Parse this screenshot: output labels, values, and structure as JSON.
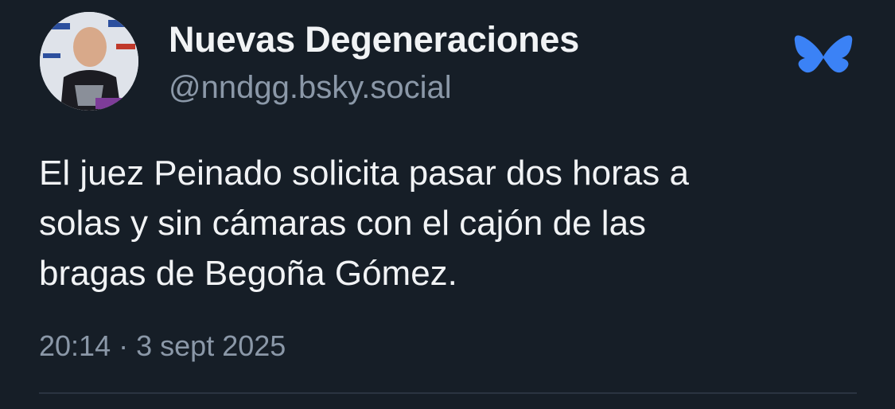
{
  "author": {
    "display_name": "Nuevas Degeneraciones",
    "handle": "@nndgg.bsky.social"
  },
  "post": {
    "lines": [
      "El juez Peinado solicita pasar dos horas a",
      "solas y sin cámaras con el cajón de las",
      "bragas de Begoña Gómez."
    ],
    "time": "20:14",
    "separator": "·",
    "date": "3 sept 2025"
  },
  "icons": {
    "logo": "bluesky-butterfly-icon"
  },
  "colors": {
    "background": "#161e27",
    "text": "#f1f3f5",
    "muted": "#8b98a8",
    "brand": "#3b82f6"
  }
}
